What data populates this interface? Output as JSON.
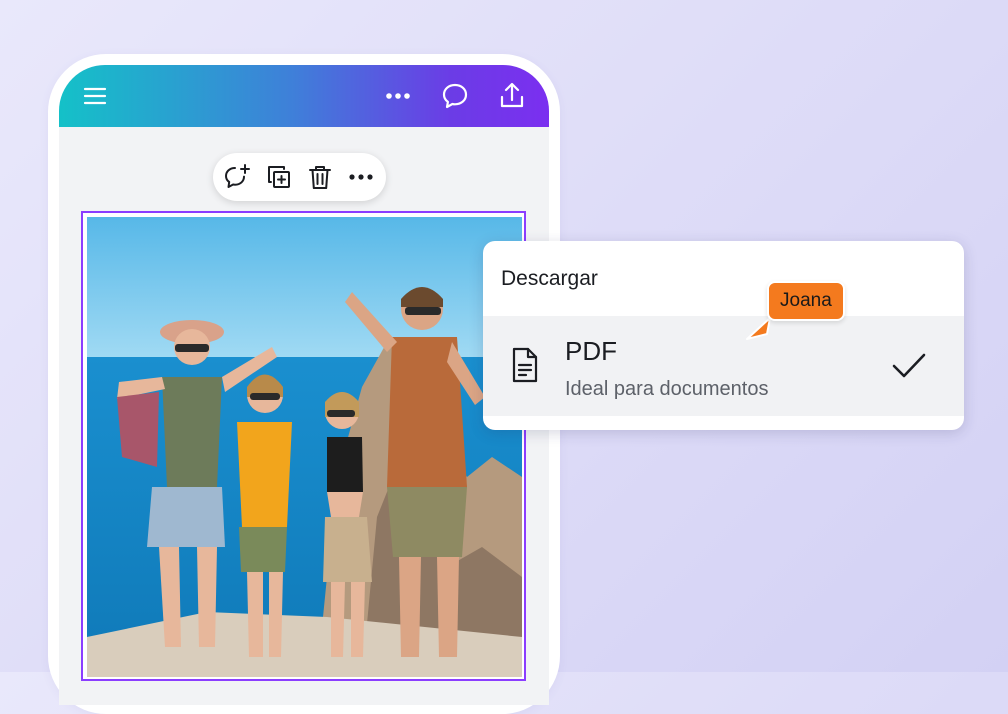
{
  "app": {
    "menu_icon": "hamburger-menu-icon",
    "more_icon": "more-horizontal-icon",
    "comment_icon": "comment-bubble-icon",
    "share_icon": "share-upload-icon"
  },
  "element_toolbar": {
    "icons": [
      "add-comment-icon",
      "duplicate-icon",
      "trash-icon",
      "more-horizontal-icon"
    ]
  },
  "download_menu": {
    "title": "Descargar",
    "option": {
      "title": "PDF",
      "description": "Ideal para documentos",
      "icon": "document-icon",
      "selected": true
    }
  },
  "collaborator": {
    "name": "Joana",
    "color": "#f47a1e"
  },
  "colors": {
    "selection_border": "#8b3dff",
    "header_gradient_start": "#14c1c8",
    "header_gradient_end": "#7b2ff0"
  }
}
